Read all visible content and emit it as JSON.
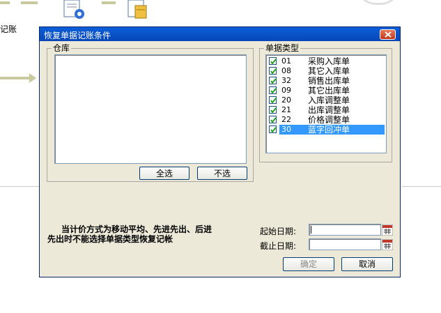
{
  "background": {
    "left_label": "记账",
    "icons": [
      "document-gear-icon",
      "document-calendar-icon"
    ]
  },
  "dialog": {
    "title": "恢复单据记账条件",
    "warehouse_group": {
      "label": "仓库",
      "select_all_label": "全选",
      "select_none_label": "不选"
    },
    "doc_type_group": {
      "label": "单据类型",
      "items": [
        {
          "code": "01",
          "name": "采购入库单",
          "checked": true,
          "selected": false
        },
        {
          "code": "08",
          "name": "其它入库单",
          "checked": true,
          "selected": false
        },
        {
          "code": "32",
          "name": "销售出库单",
          "checked": true,
          "selected": false
        },
        {
          "code": "09",
          "name": "其它出库单",
          "checked": true,
          "selected": false
        },
        {
          "code": "20",
          "name": "入库调整单",
          "checked": true,
          "selected": false
        },
        {
          "code": "21",
          "name": "出库调整单",
          "checked": true,
          "selected": false
        },
        {
          "code": "22",
          "name": "价格调整单",
          "checked": true,
          "selected": false
        },
        {
          "code": "30",
          "name": "蓝字回冲单",
          "checked": true,
          "selected": true
        }
      ]
    },
    "note_line1": "当计价方式为移动平均、先进先出、后进",
    "note_line2": "先出时不能选择单据类型恢复记帐",
    "start_date_label": "起始日期:",
    "start_date_value": "",
    "end_date_label": "截止日期:",
    "end_date_value": "",
    "ok_label": "确定",
    "cancel_label": "取消"
  }
}
